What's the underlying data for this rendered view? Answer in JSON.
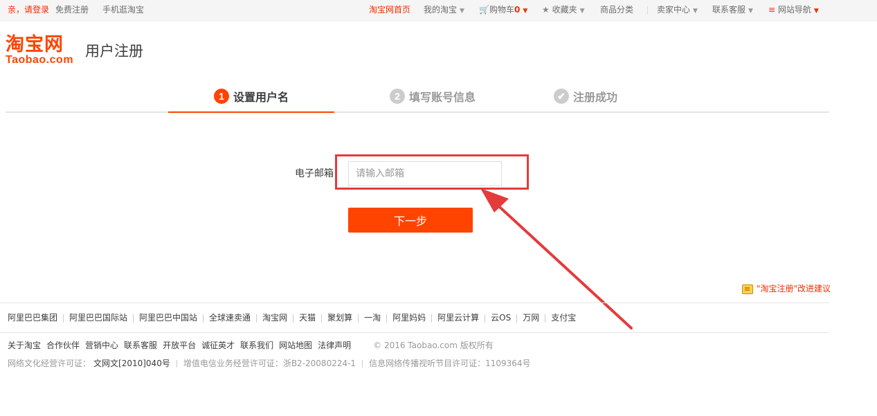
{
  "topbar": {
    "greeting": "亲，请登录",
    "register": "免费注册",
    "mobile": "手机逛淘宝",
    "home": "淘宝网首页",
    "my_taobao": "我的淘宝",
    "cart": "购物车",
    "cart_count": "0",
    "favorites": "收藏夹",
    "categories": "商品分类",
    "seller_center": "卖家中心",
    "customer_service": "联系客服",
    "site_nav": "网站导航"
  },
  "logo": {
    "cn": "淘宝网",
    "en": "Taobao.com"
  },
  "page_title": "用户注册",
  "steps": [
    {
      "number": "1",
      "label": "设置用户名",
      "state": "active"
    },
    {
      "number": "2",
      "label": "填写账号信息",
      "state": "inactive"
    },
    {
      "number": "✔",
      "label": "注册成功",
      "state": "inactive"
    }
  ],
  "form": {
    "email_label": "电子邮箱",
    "email_placeholder": "请输入邮箱",
    "email_value": "",
    "next_button": "下一步"
  },
  "feedback": "\"淘宝注册\"改进建议",
  "footer": {
    "partners": [
      "阿里巴巴集团",
      "阿里巴巴国际站",
      "阿里巴巴中国站",
      "全球速卖通",
      "淘宝网",
      "天猫",
      "聚划算",
      "一淘",
      "阿里妈妈",
      "阿里云计算",
      "云OS",
      "万网",
      "支付宝"
    ],
    "about": [
      "关于淘宝",
      "合作伙伴",
      "营销中心",
      "联系客服",
      "开放平台",
      "诚征英才",
      "联系我们",
      "网站地图",
      "法律声明"
    ],
    "copyright": "© 2016 Taobao.com 版权所有",
    "licenses": [
      {
        "label": "网络文化经营许可证：",
        "value": "文网文[2010]040号"
      },
      {
        "label": "增值电信业务经营许可证：浙B2-20080224-1",
        "value": ""
      },
      {
        "label": "信息网络传播视听节目许可证：1109364号",
        "value": ""
      }
    ]
  },
  "colors": {
    "brand": "#ff4400",
    "annotation": "#e43b3b",
    "link_red": "#f22e00"
  }
}
